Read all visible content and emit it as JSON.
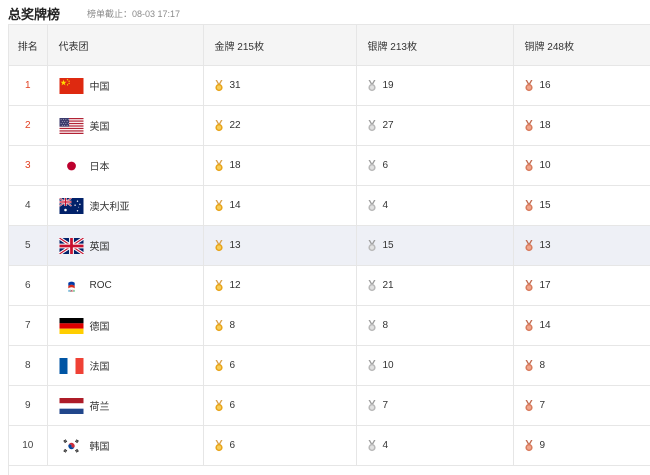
{
  "header": {
    "title": "总奖牌榜",
    "update_note": "榜单截止：08-03 17:17"
  },
  "columns": {
    "rank": "排名",
    "team": "代表团",
    "gold": "金牌 215枚",
    "silver": "银牌 213枚",
    "bronze": "铜牌 248枚"
  },
  "colors": {
    "top_rank": "#e23f20",
    "gold_medal": "#e8a317",
    "silver_medal": "#b9b9b9",
    "bronze_medal": "#d97a5b",
    "highlight_row": "#eef0f6"
  },
  "rows": [
    {
      "rank": "1",
      "country": "中国",
      "flag": "china-flag",
      "gold": "31",
      "silver": "19",
      "bronze": "16",
      "top": true
    },
    {
      "rank": "2",
      "country": "美国",
      "flag": "usa-flag",
      "gold": "22",
      "silver": "27",
      "bronze": "18",
      "top": true
    },
    {
      "rank": "3",
      "country": "日本",
      "flag": "japan-flag",
      "gold": "18",
      "silver": "6",
      "bronze": "10",
      "top": true
    },
    {
      "rank": "4",
      "country": "澳大利亚",
      "flag": "australia-flag",
      "gold": "14",
      "silver": "4",
      "bronze": "15"
    },
    {
      "rank": "5",
      "country": "英国",
      "flag": "uk-flag",
      "gold": "13",
      "silver": "15",
      "bronze": "13",
      "highlighted": true
    },
    {
      "rank": "6",
      "country": "ROC",
      "flag": "roc-flag",
      "gold": "12",
      "silver": "21",
      "bronze": "17"
    },
    {
      "rank": "7",
      "country": "德国",
      "flag": "germany-flag",
      "gold": "8",
      "silver": "8",
      "bronze": "14"
    },
    {
      "rank": "8",
      "country": "法国",
      "flag": "france-flag",
      "gold": "6",
      "silver": "10",
      "bronze": "8"
    },
    {
      "rank": "9",
      "country": "荷兰",
      "flag": "netherlands-flag",
      "gold": "6",
      "silver": "7",
      "bronze": "7"
    },
    {
      "rank": "10",
      "country": "韩国",
      "flag": "korea-flag",
      "gold": "6",
      "silver": "4",
      "bronze": "9"
    }
  ]
}
